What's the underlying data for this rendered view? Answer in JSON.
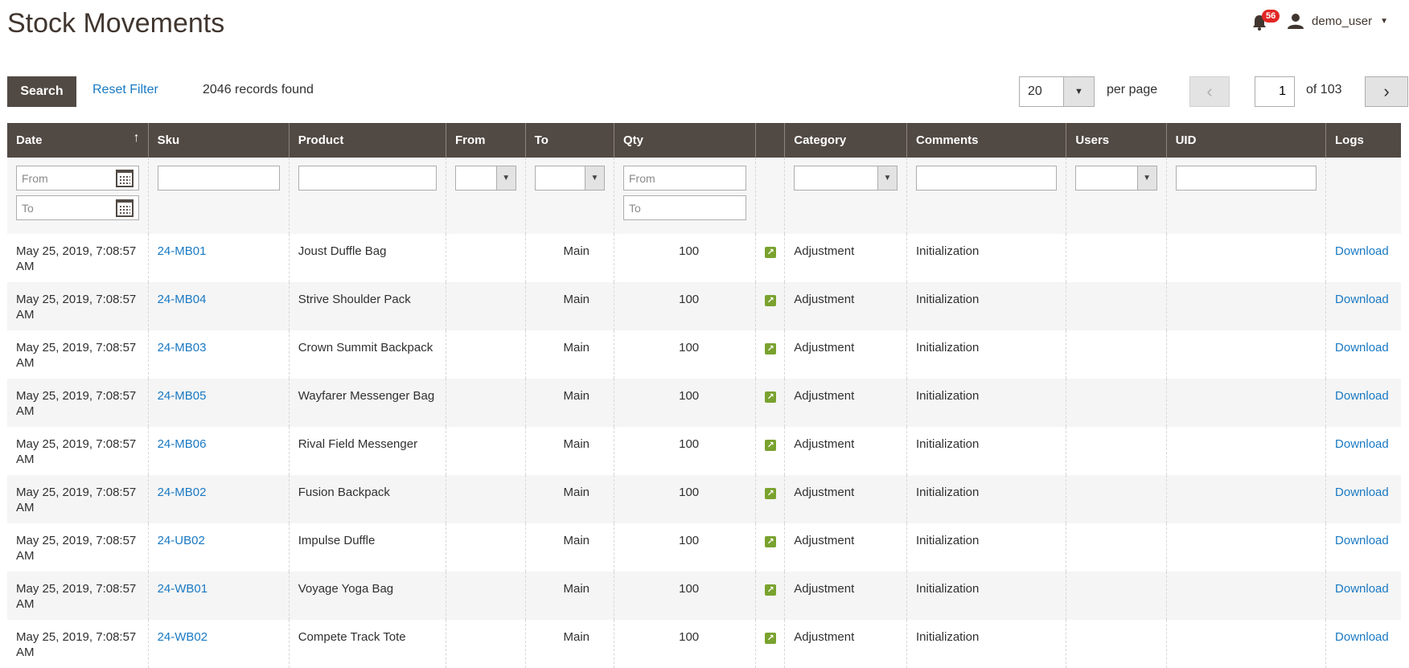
{
  "page": {
    "title": "Stock Movements"
  },
  "header": {
    "notifications_count": "56",
    "username": "demo_user"
  },
  "toolbar": {
    "search_label": "Search",
    "reset_label": "Reset Filter",
    "records_found": "2046 records found",
    "per_page_value": "20",
    "per_page_label": "per page",
    "current_page": "1",
    "of_pages": "of 103"
  },
  "columns": [
    "Date",
    "Sku",
    "Product",
    "From",
    "To",
    "Qty",
    "",
    "Category",
    "Comments",
    "Users",
    "UID",
    "Logs"
  ],
  "filters": {
    "from_placeholder": "From",
    "to_placeholder": "To"
  },
  "rows": [
    {
      "date": "May 25, 2019, 7:08:57 AM",
      "sku": "24-MB01",
      "product": "Joust Duffle Bag",
      "from": "",
      "to": "Main",
      "qty": "100",
      "category": "Adjustment",
      "comments": "Initialization",
      "users": "",
      "uid": "",
      "logs": "Download"
    },
    {
      "date": "May 25, 2019, 7:08:57 AM",
      "sku": "24-MB04",
      "product": "Strive Shoulder Pack",
      "from": "",
      "to": "Main",
      "qty": "100",
      "category": "Adjustment",
      "comments": "Initialization",
      "users": "",
      "uid": "",
      "logs": "Download"
    },
    {
      "date": "May 25, 2019, 7:08:57 AM",
      "sku": "24-MB03",
      "product": "Crown Summit Backpack",
      "from": "",
      "to": "Main",
      "qty": "100",
      "category": "Adjustment",
      "comments": "Initialization",
      "users": "",
      "uid": "",
      "logs": "Download"
    },
    {
      "date": "May 25, 2019, 7:08:57 AM",
      "sku": "24-MB05",
      "product": "Wayfarer Messenger Bag",
      "from": "",
      "to": "Main",
      "qty": "100",
      "category": "Adjustment",
      "comments": "Initialization",
      "users": "",
      "uid": "",
      "logs": "Download"
    },
    {
      "date": "May 25, 2019, 7:08:57 AM",
      "sku": "24-MB06",
      "product": "Rival Field Messenger",
      "from": "",
      "to": "Main",
      "qty": "100",
      "category": "Adjustment",
      "comments": "Initialization",
      "users": "",
      "uid": "",
      "logs": "Download"
    },
    {
      "date": "May 25, 2019, 7:08:57 AM",
      "sku": "24-MB02",
      "product": "Fusion Backpack",
      "from": "",
      "to": "Main",
      "qty": "100",
      "category": "Adjustment",
      "comments": "Initialization",
      "users": "",
      "uid": "",
      "logs": "Download"
    },
    {
      "date": "May 25, 2019, 7:08:57 AM",
      "sku": "24-UB02",
      "product": "Impulse Duffle",
      "from": "",
      "to": "Main",
      "qty": "100",
      "category": "Adjustment",
      "comments": "Initialization",
      "users": "",
      "uid": "",
      "logs": "Download"
    },
    {
      "date": "May 25, 2019, 7:08:57 AM",
      "sku": "24-WB01",
      "product": "Voyage Yoga Bag",
      "from": "",
      "to": "Main",
      "qty": "100",
      "category": "Adjustment",
      "comments": "Initialization",
      "users": "",
      "uid": "",
      "logs": "Download"
    },
    {
      "date": "May 25, 2019, 7:08:57 AM",
      "sku": "24-WB02",
      "product": "Compete Track Tote",
      "from": "",
      "to": "Main",
      "qty": "100",
      "category": "Adjustment",
      "comments": "Initialization",
      "users": "",
      "uid": "",
      "logs": "Download"
    }
  ],
  "icons": {
    "bell": "bell-icon",
    "user": "user-icon",
    "calendar": "calendar-icon",
    "movement": "arrow-up-right-icon"
  }
}
